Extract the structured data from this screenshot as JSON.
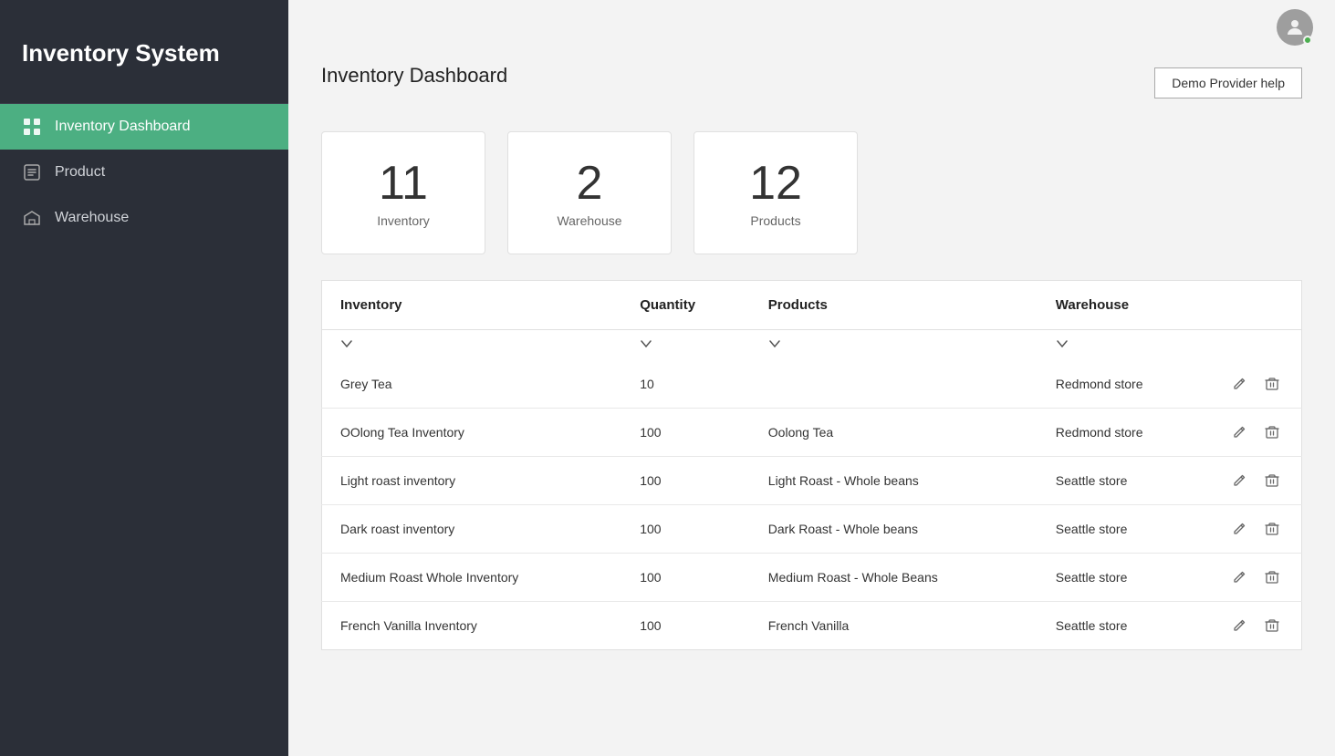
{
  "app": {
    "title": "Inventory System"
  },
  "sidebar": {
    "items": [
      {
        "id": "inventory-dashboard",
        "label": "Inventory Dashboard",
        "active": true,
        "icon": "dashboard-icon"
      },
      {
        "id": "product",
        "label": "Product",
        "active": false,
        "icon": "product-icon"
      },
      {
        "id": "warehouse",
        "label": "Warehouse",
        "active": false,
        "icon": "warehouse-icon"
      }
    ]
  },
  "header": {
    "help_button_label": "Demo Provider help"
  },
  "dashboard": {
    "title": "Inventory Dashboard",
    "stats": [
      {
        "number": "11",
        "label": "Inventory"
      },
      {
        "number": "2",
        "label": "Warehouse"
      },
      {
        "number": "12",
        "label": "Products"
      }
    ]
  },
  "table": {
    "columns": [
      "Inventory",
      "Quantity",
      "Products",
      "Warehouse"
    ],
    "rows": [
      {
        "inventory": "Grey Tea",
        "quantity": "10",
        "product": "",
        "warehouse": "Redmond store"
      },
      {
        "inventory": "OOlong Tea Inventory",
        "quantity": "100",
        "product": "Oolong Tea",
        "warehouse": "Redmond store"
      },
      {
        "inventory": "Light roast inventory",
        "quantity": "100",
        "product": "Light Roast - Whole beans",
        "warehouse": "Seattle store"
      },
      {
        "inventory": "Dark roast inventory",
        "quantity": "100",
        "product": "Dark Roast - Whole beans",
        "warehouse": "Seattle store"
      },
      {
        "inventory": "Medium Roast Whole Inventory",
        "quantity": "100",
        "product": "Medium Roast - Whole Beans",
        "warehouse": "Seattle store"
      },
      {
        "inventory": "French Vanilla Inventory",
        "quantity": "100",
        "product": "French Vanilla",
        "warehouse": "Seattle store"
      }
    ]
  }
}
